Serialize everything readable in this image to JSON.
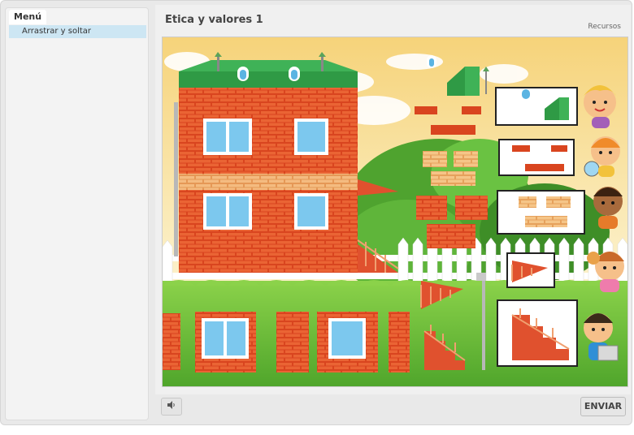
{
  "sidebar": {
    "menu_label": "Menú",
    "items": [
      {
        "label": "Arrastrar y soltar",
        "selected": true
      }
    ]
  },
  "header": {
    "title": "Etica y valores 1",
    "resources_label": "Recursos"
  },
  "activity": {
    "type": "drag-and-drop",
    "target_count": 5,
    "pieces": [
      "roof-piece",
      "bricks-top",
      "bricks-light",
      "balcony-small",
      "stairs-railing"
    ]
  },
  "footer": {
    "sound_icon": "speaker-icon",
    "send_label": "ENVIAR"
  },
  "colors": {
    "selected_item_bg": "#cde6f3",
    "brick_red": "#e0512e",
    "roof_green": "#2f9a45",
    "grass_green": "#6cc23b"
  }
}
